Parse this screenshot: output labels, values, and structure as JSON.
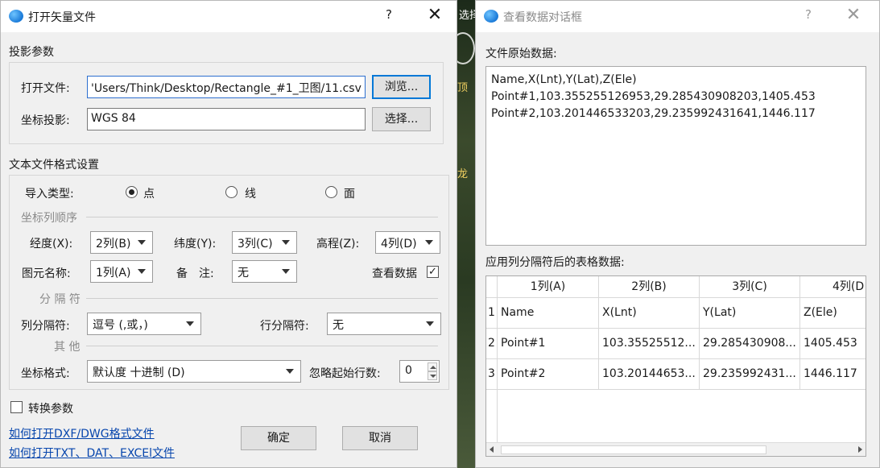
{
  "background_map": {
    "label_top": "选择",
    "label_mid": "顶",
    "label_low": "龙"
  },
  "open_dialog": {
    "title": "打开矢量文件",
    "help": "?",
    "close": "✕",
    "projection_section": "投影参数",
    "open_file_label": "打开文件:",
    "open_file_value": "'Users/Think/Desktop/Rectangle_#1_卫图/11.csv",
    "browse_label": "浏览...",
    "coord_projection_label": "坐标投影:",
    "coord_projection_value": "WGS 84",
    "select_label": "选择...",
    "text_format_section": "文本文件格式设置",
    "import_type_label": "导入类型:",
    "import_types": [
      "点",
      "线",
      "面"
    ],
    "coord_order_title": "坐标列顺序",
    "lon_label": "经度(X):",
    "lon_value": "2列(B)",
    "lat_label": "纬度(Y):",
    "lat_value": "3列(C)",
    "elev_label": "高程(Z):",
    "elev_value": "4列(D)",
    "feature_name_label": "图元名称:",
    "feature_name_value": "1列(A)",
    "remark_label": "备　注:",
    "remark_value": "无",
    "view_data_label": "查看数据",
    "view_data_checked": "✓",
    "delimiter_title": "分 隔 符",
    "col_delim_label": "列分隔符:",
    "col_delim_value": "逗号 (,或，)",
    "row_delim_label": "行分隔符:",
    "row_delim_value": "无",
    "other_title": "其 他",
    "coord_format_label": "坐标格式:",
    "coord_format_value": "默认度 十进制 (D)",
    "skip_rows_label": "忽略起始行数:",
    "skip_rows_value": "0",
    "convert_params_label": "转换参数",
    "link_dxf": "如何打开DXF/DWG格式文件",
    "link_txt": "如何打开TXT、DAT、EXCEl文件",
    "ok_label": "确定",
    "cancel_label": "取消"
  },
  "data_dialog": {
    "title": "查看数据对话框",
    "help": "?",
    "close": "✕",
    "raw_label": "文件原始数据:",
    "raw_lines": [
      "Name,X(Lnt),Y(Lat),Z(Ele)",
      "Point#1,103.355255126953,29.285430908203,1405.453",
      "Point#2,103.201446533203,29.235992431641,1446.117"
    ],
    "table_label": "应用列分隔符后的表格数据:",
    "columns": [
      "1列(A)",
      "2列(B)",
      "3列(C)",
      "4列(D"
    ],
    "rows": [
      {
        "idx": "1",
        "cells": [
          "Name",
          "X(Lnt)",
          "Y(Lat)",
          "Z(Ele)"
        ]
      },
      {
        "idx": "2",
        "cells": [
          "Point#1",
          "103.35525512...",
          "29.285430908...",
          "1405.453"
        ]
      },
      {
        "idx": "3",
        "cells": [
          "Point#2",
          "103.20144653...",
          "29.235992431...",
          "1446.117"
        ]
      }
    ]
  }
}
